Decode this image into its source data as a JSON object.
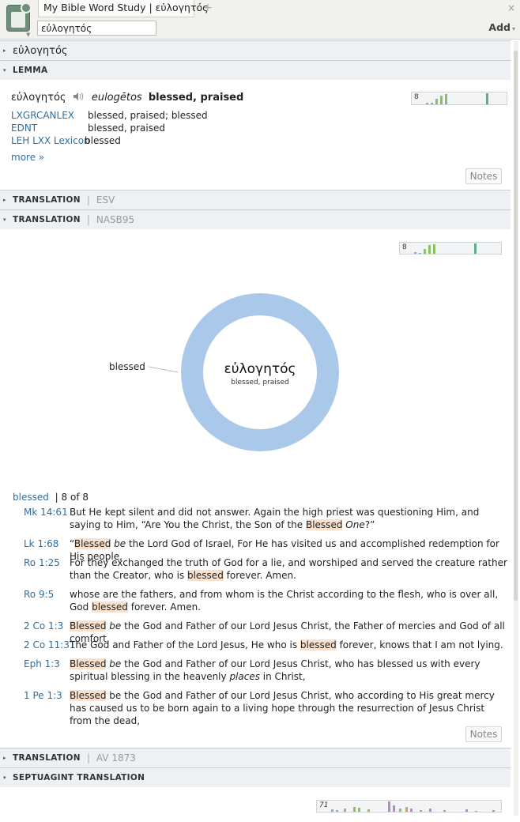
{
  "window": {
    "tab_title": "My Bible Word Study | εὐλογητός",
    "tab_plus": "+",
    "tab_close": "×",
    "search_value": "εὐλογητός",
    "add_label": "Add",
    "add_arrow": "▾"
  },
  "word_section": {
    "title": "εὐλογητός",
    "arrow": "▸"
  },
  "lemma": {
    "header": "LEMMA",
    "arrow": "▾",
    "greek": "εὐλογητός",
    "speaker_icon": "speaker-icon",
    "translit": "eulogētos",
    "gloss": "blessed, praised",
    "lexicons": [
      {
        "name": "LXGRCANLEX",
        "def": "blessed, praised; blessed"
      },
      {
        "name": "EDNT",
        "def": "blessed, praised"
      },
      {
        "name": "LEH LXX Lexicon",
        "def": "blessed"
      }
    ],
    "more": "more »",
    "notes": "Notes",
    "minichart_label": "8",
    "minichart_bars": [
      {
        "h": 0.15,
        "color": "#8ea6d8"
      },
      {
        "h": 0.1,
        "color": "#8ea6d8"
      },
      {
        "h": 0.45,
        "color": "#8bc064"
      },
      {
        "h": 0.75,
        "color": "#8bc064"
      },
      {
        "h": 0.85,
        "color": "#8bc064"
      },
      {
        "h": 0.95,
        "color": "#5bae8a"
      }
    ]
  },
  "translation_esv": {
    "header": "TRANSLATION",
    "sep": "|",
    "version": "ESV",
    "arrow": "▸"
  },
  "translation_nasb": {
    "header": "TRANSLATION",
    "sep": "|",
    "version": "NASB95",
    "arrow": "▾",
    "minichart_label": "8",
    "donut": {
      "center_word": "εὐλογητός",
      "center_gloss": "blessed, praised",
      "color": "#aac9ea",
      "slices": [
        {
          "label": "blessed",
          "value": 8
        }
      ]
    },
    "results_word": "blessed",
    "results_count": "| 8 of 8",
    "verses": [
      {
        "ref": "Mk 14:61",
        "parts": [
          [
            "But He kept silent and did not answer. Again the high priest was questioning Him, and saying to Him, “Are You the Christ, the Son of the ",
            ""
          ],
          [
            "Blessed",
            "hl"
          ],
          [
            " ",
            ""
          ],
          [
            "One",
            "i"
          ],
          [
            "?”",
            ""
          ]
        ]
      },
      {
        "ref": "Lk 1:68",
        "parts": [
          [
            "“",
            ""
          ],
          [
            "Blessed",
            "hl"
          ],
          [
            " ",
            ""
          ],
          [
            "be",
            "i"
          ],
          [
            " the Lord God of Israel, For He has visited us and accomplished redemption for His people,",
            ""
          ]
        ]
      },
      {
        "ref": "Ro 1:25",
        "parts": [
          [
            "For they exchanged the truth of God for a lie, and worshiped and served the creature rather than the Creator, who is ",
            ""
          ],
          [
            "blessed",
            "hl"
          ],
          [
            " forever. Amen.",
            ""
          ]
        ]
      },
      {
        "ref": "Ro 9:5",
        "parts": [
          [
            "whose are the fathers, and from whom is the Christ according to the flesh, who is over all, God ",
            ""
          ],
          [
            "blessed",
            "hl"
          ],
          [
            " forever. Amen.",
            ""
          ]
        ]
      },
      {
        "ref": "2 Co 1:3",
        "parts": [
          [
            "Blessed",
            "hl"
          ],
          [
            " ",
            ""
          ],
          [
            "be",
            "i"
          ],
          [
            " the God and Father of our Lord Jesus Christ, the Father of mercies and God of all comfort,",
            ""
          ]
        ]
      },
      {
        "ref": "2 Co 11:31",
        "parts": [
          [
            "The God and Father of the Lord Jesus, He who is ",
            ""
          ],
          [
            "blessed",
            "hl"
          ],
          [
            " forever, knows that I am not lying.",
            ""
          ]
        ]
      },
      {
        "ref": "Eph 1:3",
        "parts": [
          [
            "Blessed",
            "hl"
          ],
          [
            " ",
            ""
          ],
          [
            "be",
            "i"
          ],
          [
            " the God and Father of our Lord Jesus Christ, who has blessed us with every spiritual blessing in the heavenly ",
            ""
          ],
          [
            "places",
            "i"
          ],
          [
            " in Christ,",
            ""
          ]
        ]
      },
      {
        "ref": "1 Pe 1:3",
        "parts": [
          [
            "Blessed",
            "hl"
          ],
          [
            " be the God and Father of our Lord Jesus Christ, who according to His great mercy has caused us to be born again to a living hope through the resurrection of Jesus Christ from the dead,",
            ""
          ]
        ]
      }
    ],
    "notes": "Notes"
  },
  "translation_av": {
    "header": "TRANSLATION",
    "sep": "|",
    "version": "AV 1873",
    "arrow": "▸"
  },
  "septuagint": {
    "header": "SEPTUAGINT TRANSLATION",
    "arrow": "▾",
    "minichart_label": "71"
  }
}
